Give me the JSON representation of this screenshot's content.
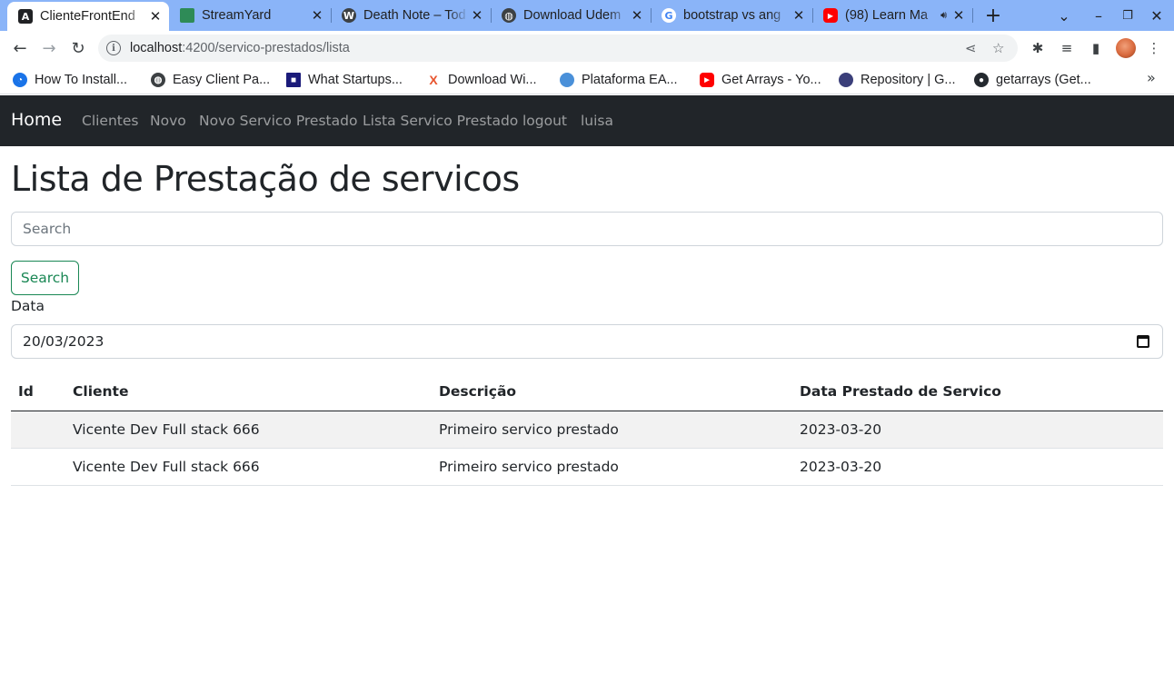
{
  "browser": {
    "tabs": [
      {
        "title": "ClienteFrontEnd",
        "icon": "angular-icon",
        "active": true
      },
      {
        "title": "StreamYard",
        "icon": "streamyard-icon",
        "active": false
      },
      {
        "title": "Death Note – Tod",
        "icon": "wordpress-icon",
        "active": false
      },
      {
        "title": "Download Udem",
        "icon": "globe-icon",
        "active": false
      },
      {
        "title": "bootstrap vs ang",
        "icon": "google-icon",
        "active": false
      },
      {
        "title": "(98) Learn Ma",
        "icon": "youtube-icon",
        "active": false
      }
    ],
    "close_glyph": "✕",
    "new_tab_glyph": "+",
    "url_host": "localhost",
    "url_path": ":4200/servico-prestados/lista",
    "bookmarks": [
      {
        "label": "How To Install...",
        "icon": "bookmark-icon"
      },
      {
        "label": "Easy Client Pa...",
        "icon": "globe-icon"
      },
      {
        "label": "What Startups...",
        "icon": "bookmark-icon"
      },
      {
        "label": "Download Wi...",
        "icon": "x-icon"
      },
      {
        "label": "Plataforma EA...",
        "icon": "globe-icon"
      },
      {
        "label": "Get Arrays - Yo...",
        "icon": "youtube-icon"
      },
      {
        "label": "Repository | G...",
        "icon": "bookmark-icon"
      },
      {
        "label": "getarrays (Get...",
        "icon": "github-icon"
      }
    ]
  },
  "navbar": {
    "brand": "Home",
    "links": [
      "Clientes",
      "Novo",
      "Novo Servico Prestado",
      "Lista Servico Prestado",
      "logout",
      "luisa"
    ]
  },
  "page": {
    "title": "Lista de Prestação de servicos",
    "search_placeholder": "Search",
    "search_button": "Search",
    "date_label": "Data",
    "date_value": "20/03/2023"
  },
  "table": {
    "headers": [
      "Id",
      "Cliente",
      "Descrição",
      "Data Prestado de Servico"
    ],
    "rows": [
      {
        "id": "",
        "cliente": "Vicente Dev Full stack 666",
        "descricao": "Primeiro servico prestado",
        "data": "2023-03-20"
      },
      {
        "id": "",
        "cliente": "Vicente Dev Full stack 666",
        "descricao": "Primeiro servico prestado",
        "data": "2023-03-20"
      }
    ]
  },
  "colors": {
    "tabstrip": "#8ab4f8",
    "navbar": "#212529",
    "success": "#198754"
  }
}
